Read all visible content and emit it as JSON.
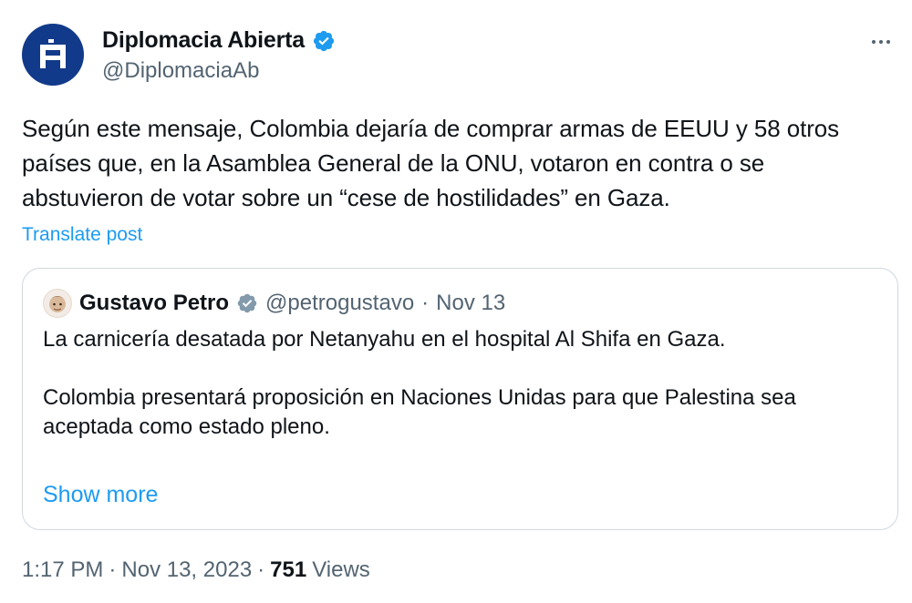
{
  "author": {
    "display_name": "Diplomacia Abierta",
    "handle": "@DiplomaciaAb",
    "verified": true,
    "verified_color": "#1d9bf0",
    "avatar_color": "#123a8a"
  },
  "more_icon": "ellipsis-icon",
  "post": {
    "text": "Según este mensaje, Colombia dejaría de comprar armas de EEUU y 58 otros países que, en la Asamblea General de la ONU, votaron en contra o se abstuvieron de votar sobre un “cese de hostilidades” en Gaza.",
    "translate_label": "Translate post"
  },
  "quote": {
    "display_name": "Gustavo Petro",
    "verified_badge": "gray-verified-badge-icon",
    "handle": "@petrogustavo",
    "separator": "·",
    "date": "Nov 13",
    "paragraph1": "La carnicería desatada por Netanyahu en el hospital Al Shifa en Gaza.",
    "paragraph2": "Colombia presentará proposición en Naciones Unidas para que Palestina sea aceptada como estado pleno.",
    "show_more_label": "Show more"
  },
  "footer": {
    "time": "1:17 PM",
    "separator1": "·",
    "date": "Nov 13, 2023",
    "separator2": "·",
    "views_count": "751",
    "views_label": "Views"
  },
  "colors": {
    "link": "#1d9bf0",
    "secondary_text": "#536471",
    "border": "#cfd9de"
  }
}
